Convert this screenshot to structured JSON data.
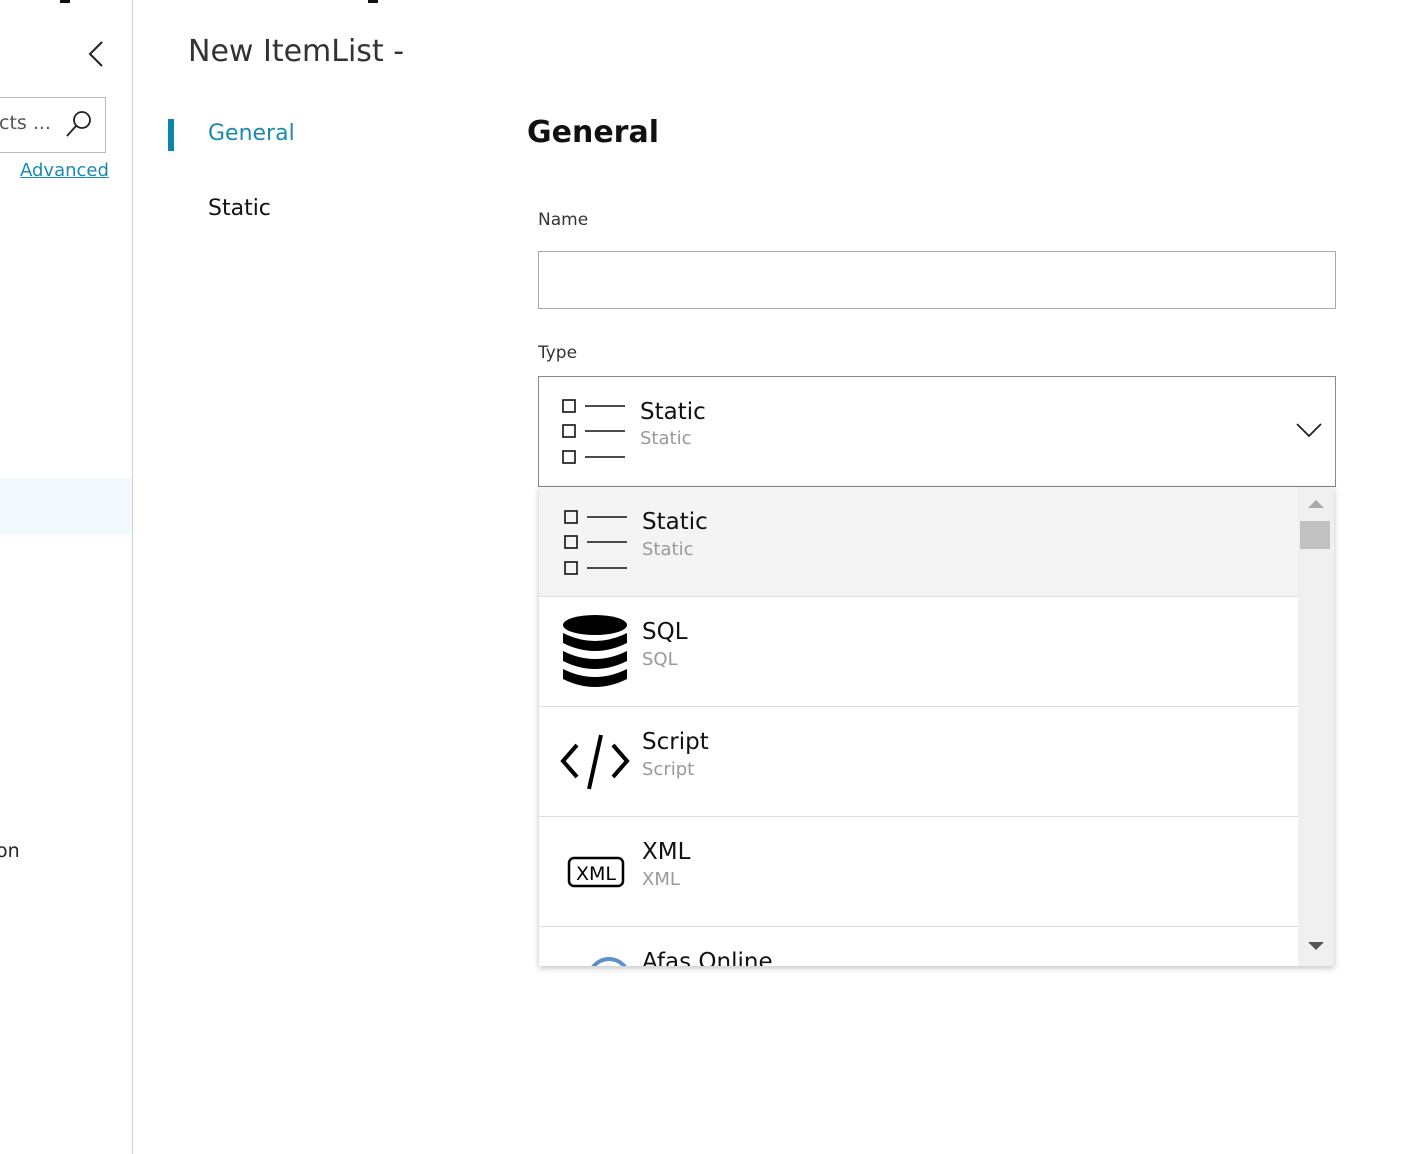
{
  "sidebar": {
    "search_placeholder": "cts ...",
    "advanced_link": "Advanced",
    "partial_item": "on"
  },
  "header": {
    "title": "New ItemList -"
  },
  "nav": {
    "items": [
      {
        "label": "General",
        "active": true
      },
      {
        "label": "Static"
      }
    ],
    "accent": "#0a86ad"
  },
  "form": {
    "heading": "General",
    "name_label": "Name",
    "name_value": "",
    "type_label": "Type",
    "type_selected": {
      "title": "Static",
      "subtitle": "Static",
      "icon": "checklist-icon"
    },
    "type_options": [
      {
        "title": "Static",
        "subtitle": "Static",
        "icon": "checklist-icon"
      },
      {
        "title": "SQL",
        "subtitle": "SQL",
        "icon": "database-icon"
      },
      {
        "title": "Script",
        "subtitle": "Script",
        "icon": "code-icon"
      },
      {
        "title": "XML",
        "subtitle": "XML",
        "icon": "xml-icon"
      },
      {
        "title": "Afas Online",
        "subtitle": "",
        "icon": "afas-icon"
      }
    ]
  }
}
